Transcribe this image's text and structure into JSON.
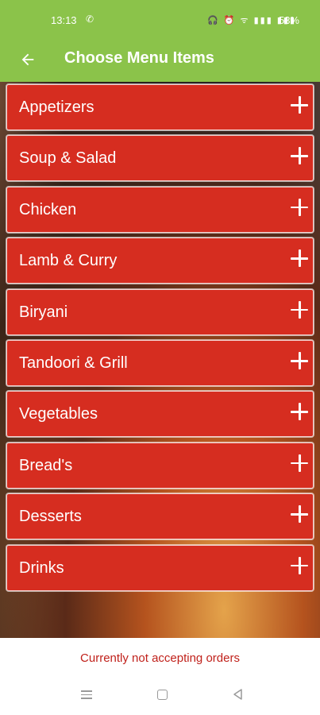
{
  "status_bar": {
    "time": "13:13",
    "call_icon": "phone-icon",
    "icons": "🎧 ⏰ ᯤ ▮▮▮ ▮▮▮",
    "battery": "53%"
  },
  "app_bar": {
    "title": "Choose Menu Items",
    "back_icon": "arrow-left-icon",
    "color": "#8bc34a"
  },
  "menu": {
    "accent": "#d62d20",
    "items": [
      {
        "label": "Appetizers"
      },
      {
        "label": "Soup & Salad"
      },
      {
        "label": "Chicken"
      },
      {
        "label": "Lamb & Curry"
      },
      {
        "label": "Biryani"
      },
      {
        "label": "Tandoori & Grill"
      },
      {
        "label": "Vegetables"
      },
      {
        "label": "Bread's"
      },
      {
        "label": "Desserts"
      },
      {
        "label": "Drinks"
      }
    ]
  },
  "footer": {
    "status_text": "Currently not accepting orders",
    "status_color": "#c0211b"
  },
  "nav_bar": {
    "buttons": [
      "menu-icon",
      "home-icon",
      "back-triangle-icon"
    ]
  }
}
